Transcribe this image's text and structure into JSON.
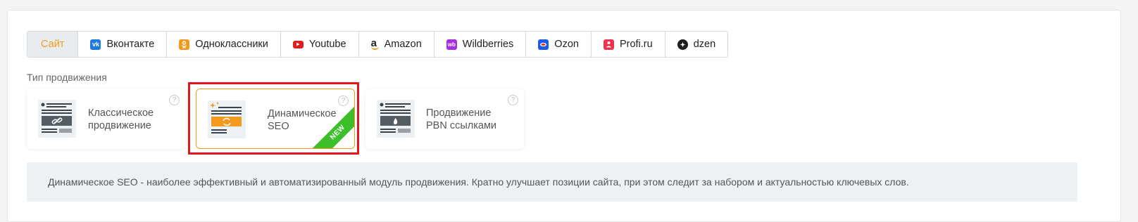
{
  "tabs": [
    {
      "label": "Сайт",
      "icon": "none",
      "active": true
    },
    {
      "label": "Вконтакте",
      "icon": "vk-icon",
      "color": "#1f7ae0"
    },
    {
      "label": "Одноклассники",
      "icon": "odnoklassniki-icon",
      "color": "#f39a1e"
    },
    {
      "label": "Youtube",
      "icon": "youtube-icon",
      "color": "#e21d1d"
    },
    {
      "label": "Amazon",
      "icon": "amazon-icon",
      "color": "#222222"
    },
    {
      "label": "Wildberries",
      "icon": "wildberries-icon",
      "color": "#a62ee3"
    },
    {
      "label": "Ozon",
      "icon": "ozon-icon",
      "color": "#1b5be8"
    },
    {
      "label": "Profi.ru",
      "icon": "profi-icon",
      "color": "#f0334d"
    },
    {
      "label": "dzen",
      "icon": "dzen-icon",
      "color": "#1e1e1e"
    }
  ],
  "promotion": {
    "label": "Тип продвижения",
    "cards": [
      {
        "line1": "Классическое",
        "line2": "продвижение",
        "icon": "link-document-icon",
        "help": "?"
      },
      {
        "line1": "Динамическое",
        "line2": "SEO",
        "icon": "refresh-document-icon",
        "help": "?",
        "selected": true,
        "badge": "NEW"
      },
      {
        "line1": "Продвижение",
        "line2": "PBN ссылками",
        "icon": "fire-document-icon",
        "help": "?"
      }
    ]
  },
  "description": "Динамическое SEO - наиболее эффективный и автоматизированный модуль продвижения. Кратно улучшает позиции сайта, при этом следит за набором и актуальностью ключевых слов.",
  "colors": {
    "accent": "#f39a1e",
    "highlight": "#e3141b",
    "new_badge": "#3cbf2a"
  }
}
